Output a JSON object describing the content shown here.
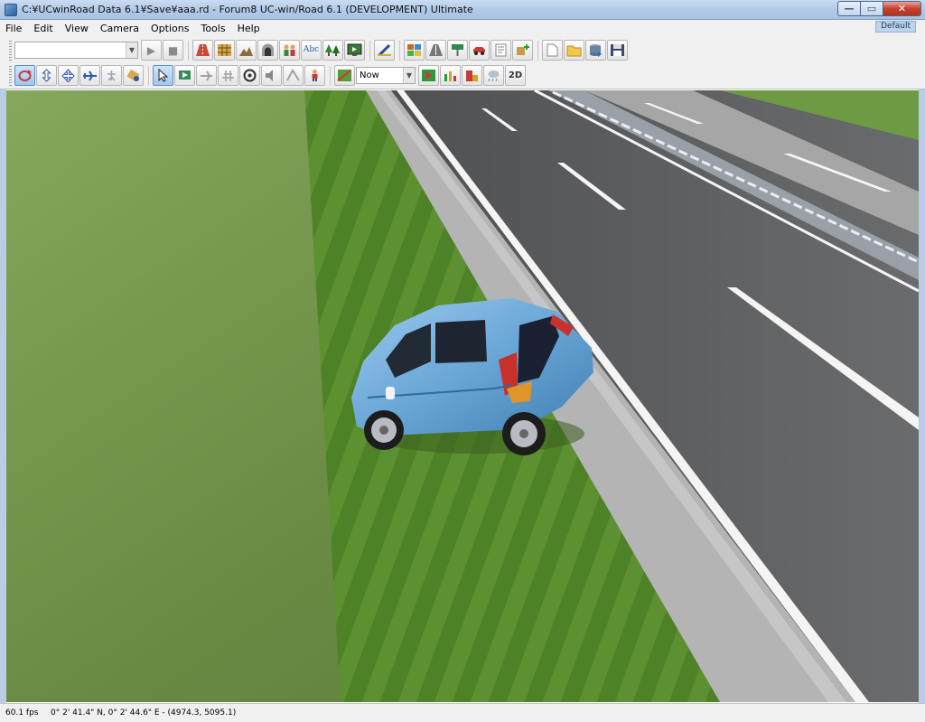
{
  "window": {
    "title": "C:¥UCwinRoad Data 6.1¥Save¥aaa.rd - Forum8 UC-win/Road 6.1 (DEVELOPMENT) Ultimate",
    "min_glyph": "—",
    "max_glyph": "▭",
    "close_glyph": "✕"
  },
  "menu": {
    "file": "File",
    "edit": "Edit",
    "view": "View",
    "camera": "Camera",
    "options": "Options",
    "tools": "Tools",
    "help": "Help",
    "profile_badge": "Default"
  },
  "toolbar": {
    "scenario_combo_value": "",
    "time_combo_value": "Now",
    "play_glyph": "▶",
    "stop_glyph": "■",
    "view_2d_label": "2D"
  },
  "statusbar": {
    "fps": "60.1 fps",
    "coords": "0°  2' 41.4\" N, 0°  2' 44.6\" E  -  (4974.3, 5095.1)"
  },
  "colors": {
    "asphalt": "#5d5e5f",
    "grass": "#5a8a2e",
    "terrain": "#6c8a48",
    "curb": "#b8b8b8",
    "car_body": "#6aa6d6",
    "lane_marking": "#ffffff"
  }
}
